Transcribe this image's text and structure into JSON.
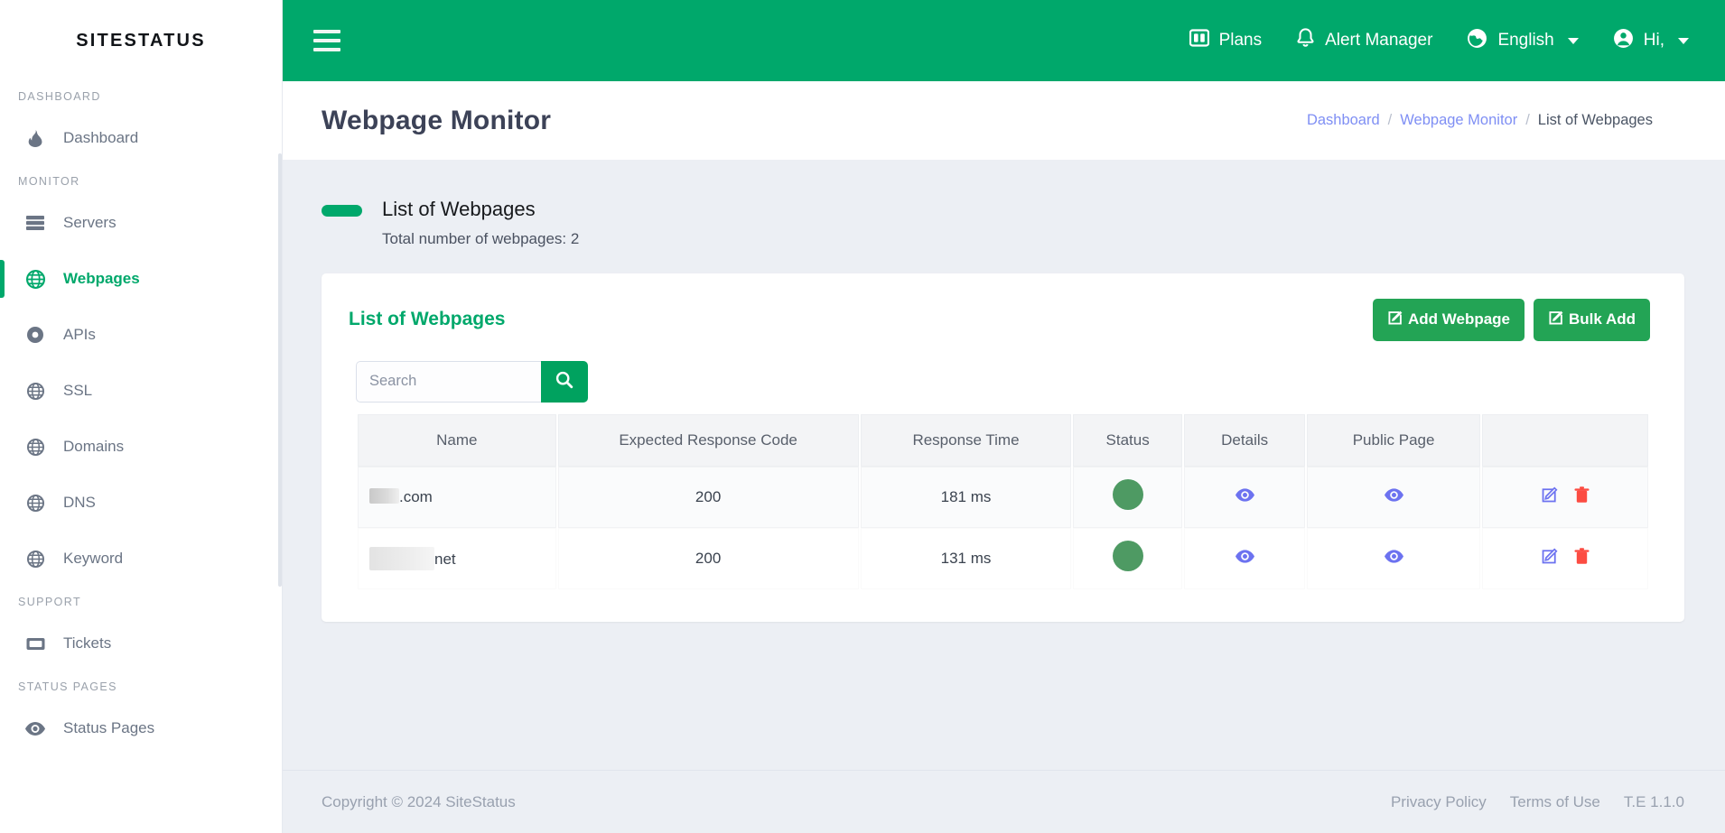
{
  "brand": {
    "name": "SITESTATUS"
  },
  "sidebar": {
    "sections": [
      {
        "label": "DASHBOARD",
        "items": [
          {
            "label": "Dashboard",
            "icon": "flame-icon",
            "active": false
          }
        ]
      },
      {
        "label": "MONITOR",
        "items": [
          {
            "label": "Servers",
            "icon": "server-icon",
            "active": false
          },
          {
            "label": "Webpages",
            "icon": "globe-icon",
            "active": true
          },
          {
            "label": "APIs",
            "icon": "circle-dot-icon",
            "active": false
          },
          {
            "label": "SSL",
            "icon": "globe-icon",
            "active": false
          },
          {
            "label": "Domains",
            "icon": "globe-icon",
            "active": false
          },
          {
            "label": "DNS",
            "icon": "globe-icon",
            "active": false
          },
          {
            "label": "Keyword",
            "icon": "globe-icon",
            "active": false
          }
        ]
      },
      {
        "label": "SUPPORT",
        "items": [
          {
            "label": "Tickets",
            "icon": "ticket-icon",
            "active": false
          }
        ]
      },
      {
        "label": "STATUS PAGES",
        "items": [
          {
            "label": "Status Pages",
            "icon": "eye-icon",
            "active": false
          }
        ]
      }
    ]
  },
  "topbar": {
    "menu_icon": "hamburger-icon",
    "items": [
      {
        "label": "Plans",
        "icon": "plans-icon",
        "caret": false
      },
      {
        "label": "Alert Manager",
        "icon": "bell-icon",
        "caret": false
      },
      {
        "label": "English",
        "icon": "globe-language-icon",
        "caret": true
      },
      {
        "label": "Hi,",
        "icon": "user-icon",
        "caret": true
      }
    ]
  },
  "page": {
    "title": "Webpage Monitor",
    "breadcrumb": [
      {
        "label": "Dashboard",
        "link": true
      },
      {
        "label": "/",
        "sep": true
      },
      {
        "label": "Webpage Monitor",
        "link": true
      },
      {
        "label": "/",
        "sep": true
      },
      {
        "label": "List of Webpages",
        "link": false
      }
    ]
  },
  "section": {
    "title": "List of Webpages",
    "subtitle": "Total number of webpages: 2"
  },
  "card": {
    "title": "List of Webpages",
    "add_webpage_label": "Add Webpage",
    "bulk_add_label": "Bulk Add"
  },
  "search": {
    "placeholder": "Search",
    "value": ""
  },
  "table": {
    "columns": [
      "Name",
      "Expected Response Code",
      "Response Time",
      "Status",
      "Details",
      "Public Page",
      ""
    ],
    "rows": [
      {
        "name_redacted_width": 33,
        "name_suffix": ".com",
        "expected_response_code": "200",
        "response_time": "181 ms",
        "status": "up",
        "details_icon": "eye-icon",
        "public_page_icon": "eye-icon",
        "edit_icon": "edit-square-icon",
        "delete_icon": "trash-icon"
      },
      {
        "name_redacted_width": 72,
        "name_suffix": "net",
        "expected_response_code": "200",
        "response_time": "131 ms",
        "status": "up",
        "details_icon": "eye-icon",
        "public_page_icon": "eye-icon",
        "edit_icon": "edit-square-icon",
        "delete_icon": "trash-icon"
      }
    ]
  },
  "footer": {
    "copyright": "Copyright © 2024 SiteStatus",
    "privacy": "Privacy Policy",
    "terms": "Terms of Use",
    "version": "T.E 1.1.0"
  },
  "colors": {
    "brand_green": "#00a86b",
    "button_green": "#23a455",
    "accent_indigo": "#6c72f0",
    "danger_red": "#fc4c42",
    "status_up": "#4e9a63",
    "page_bg": "#eceff4",
    "title_navy": "#3c4257"
  }
}
